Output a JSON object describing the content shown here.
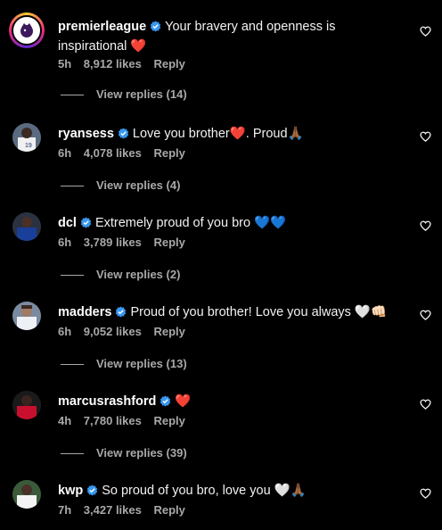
{
  "comments": [
    {
      "username": "premierleague",
      "text": "Your bravery and openness is inspirational ❤️",
      "time": "5h",
      "likes": "8,912 likes",
      "reply": "Reply",
      "view_replies": "View replies (14)"
    },
    {
      "username": "ryansess",
      "text": "Love you brother❤️. Proud🙏🏾",
      "time": "6h",
      "likes": "4,078 likes",
      "reply": "Reply",
      "view_replies": "View replies (4)"
    },
    {
      "username": "dcl",
      "text": "Extremely proud of you bro 💙💙",
      "time": "6h",
      "likes": "3,789 likes",
      "reply": "Reply",
      "view_replies": "View replies (2)"
    },
    {
      "username": "madders",
      "text": "Proud of you brother! Love you always 🤍👊🏻",
      "time": "6h",
      "likes": "9,052 likes",
      "reply": "Reply",
      "view_replies": "View replies (13)"
    },
    {
      "username": "marcusrashford",
      "text": "❤️",
      "time": "4h",
      "likes": "7,780 likes",
      "reply": "Reply",
      "view_replies": "View replies (39)"
    },
    {
      "username": "kwp",
      "text": "So proud of you bro, love you 🤍🙏🏾",
      "time": "7h",
      "likes": "3,427 likes",
      "reply": "Reply",
      "view_replies": ""
    }
  ],
  "colors": {
    "background": "#000000",
    "verified": "#3897f0",
    "muted_text": "#a8a8a8"
  },
  "icons": {
    "verified": "verified-badge-icon",
    "like": "heart-outline-icon"
  }
}
